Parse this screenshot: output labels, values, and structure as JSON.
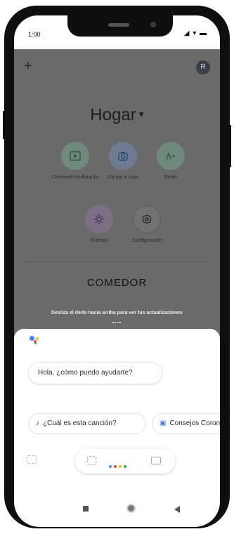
{
  "status": {
    "time": "1:00",
    "icons": "◢ ▾ ▬"
  },
  "header": {
    "add_icon": "plus-icon",
    "avatar_letter": "R"
  },
  "home": {
    "title": "Hogar",
    "caret": "▾"
  },
  "actions": [
    {
      "label": "Contenido multimedia",
      "icon": "media-icon",
      "color": "#6f8a7c"
    },
    {
      "label": "Llamar a casa",
      "icon": "call-home-icon",
      "color": "#6d7c90"
    },
    {
      "label": "Emitir",
      "icon": "cast-icon",
      "color": "#6f8a7c"
    },
    {
      "label": "Rutinas",
      "icon": "routines-icon",
      "color": "#7d6f86"
    },
    {
      "label": "Configuración",
      "icon": "settings-icon",
      "color": "#727272"
    }
  ],
  "room": {
    "name": "COMEDOR"
  },
  "hint": {
    "text": "Desliza el dedo hacia arriba para ver tus actualizaciones"
  },
  "assistant": {
    "greeting": "Hola, ¿cómo puedo ayudarte?",
    "suggestions": [
      {
        "icon": "♪",
        "label": "¿Cuál es esta canción?"
      },
      {
        "icon": "▣",
        "label": "Consejos Corona"
      }
    ],
    "dot_colors": [
      "#4285f4",
      "#ea4335",
      "#fbbc05",
      "#34a853"
    ]
  }
}
